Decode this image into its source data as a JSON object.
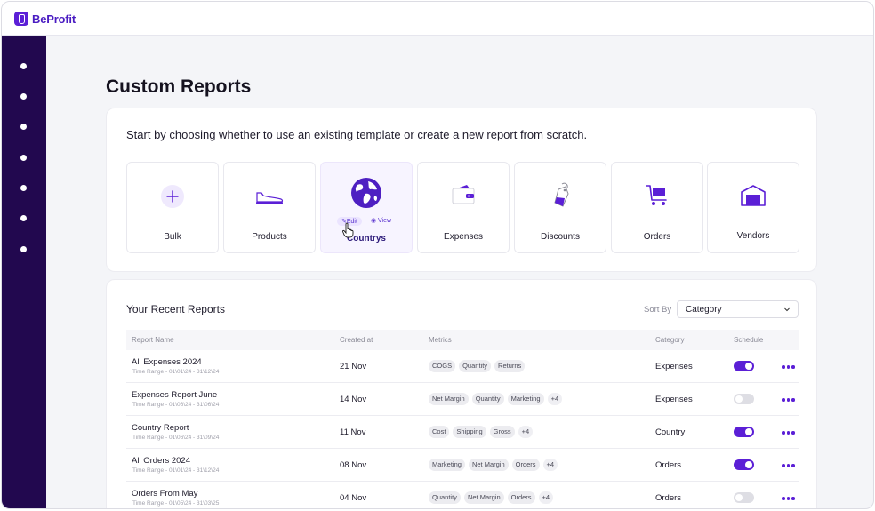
{
  "app": {
    "brand": "BeProfit"
  },
  "page": {
    "title": "Custom Reports",
    "intro": "Start by choosing whether to use an existing template or create a new report from scratch."
  },
  "templates": [
    {
      "label": "Bulk",
      "icon": "plus-icon"
    },
    {
      "label": "Products",
      "icon": "shoe-icon"
    },
    {
      "label": "Countrys",
      "icon": "globe-icon",
      "edit_label": "Edit",
      "view_label": "View"
    },
    {
      "label": "Expenses",
      "icon": "wallet-icon"
    },
    {
      "label": "Discounts",
      "icon": "price-tag-icon"
    },
    {
      "label": "Orders",
      "icon": "cart-icon"
    },
    {
      "label": "Vendors",
      "icon": "warehouse-icon"
    }
  ],
  "recent": {
    "title": "Your Recent Reports",
    "sort_label": "Sort  By",
    "sort_value": "Category",
    "columns": [
      "Report Name",
      "Created at",
      "Metrics",
      "Category",
      "Schedule"
    ],
    "rows": [
      {
        "name": "All Expenses 2024",
        "range": "Time Range - 01\\01\\24 - 31\\12\\24",
        "created": "21 Nov",
        "metrics": [
          "COGS",
          "Quantity",
          "Returns"
        ],
        "more": "",
        "category": "Expenses",
        "schedule": true
      },
      {
        "name": "Expenses Report June",
        "range": "Time Range - 01\\06\\24 - 31\\06\\24",
        "created": "14 Nov",
        "metrics": [
          "Net Margin",
          "Quantity",
          "Marketing"
        ],
        "more": "+4",
        "category": "Expenses",
        "schedule": false
      },
      {
        "name": "Country Report",
        "range": "Time Range - 01\\06\\24 - 31\\09\\24",
        "created": "11 Nov",
        "metrics": [
          "Cost",
          "Shipping",
          "Gross"
        ],
        "more": "+4",
        "category": "Country",
        "schedule": true
      },
      {
        "name": "All Orders 2024",
        "range": "Time Range - 01\\01\\24 - 31\\12\\24",
        "created": "08 Nov",
        "metrics": [
          "Marketing",
          "Net Margin",
          "Orders"
        ],
        "more": "+4",
        "category": "Orders",
        "schedule": true
      },
      {
        "name": "Orders From May",
        "range": "Time Range - 01\\05\\24 - 31\\03\\25",
        "created": "04 Nov",
        "metrics": [
          "Quantity",
          "Net Margin",
          "Orders"
        ],
        "more": "+4",
        "category": "Orders",
        "schedule": false
      }
    ]
  },
  "colors": {
    "accent": "#5b1fd6",
    "sidebar": "#22084f",
    "background": "#f4f5f8"
  }
}
